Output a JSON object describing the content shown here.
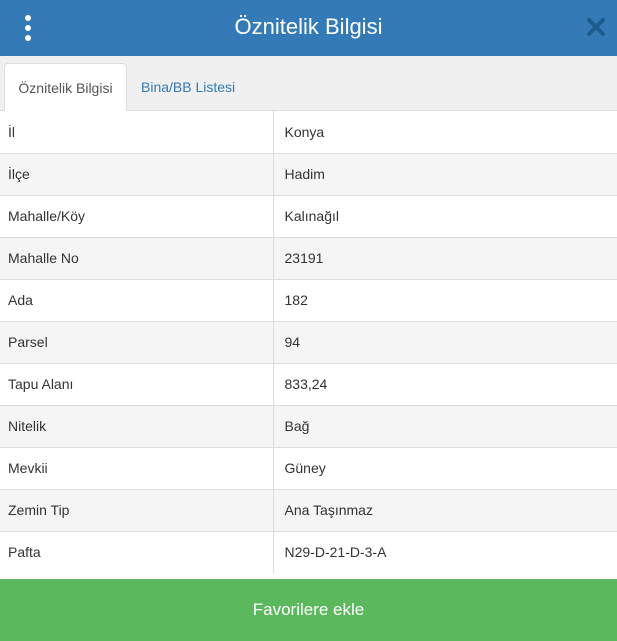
{
  "header": {
    "title": "Öznitelik Bilgisi",
    "menu_icon": "kebab-menu-icon",
    "close_icon": "close-icon",
    "background_color": "#337ab7"
  },
  "tabs": [
    {
      "label": "Öznitelik Bilgisi",
      "active": true
    },
    {
      "label": "Bina/BB Listesi",
      "active": false
    }
  ],
  "attributes": [
    {
      "key": "İl",
      "value": "Konya"
    },
    {
      "key": "İlçe",
      "value": "Hadim"
    },
    {
      "key": "Mahalle/Köy",
      "value": "Kalınağıl"
    },
    {
      "key": "Mahalle No",
      "value": "23191"
    },
    {
      "key": "Ada",
      "value": "182"
    },
    {
      "key": "Parsel",
      "value": "94"
    },
    {
      "key": "Tapu Alanı",
      "value": "833,24"
    },
    {
      "key": "Nitelik",
      "value": "Bağ"
    },
    {
      "key": "Mevkii",
      "value": "Güney"
    },
    {
      "key": "Zemin Tip",
      "value": "Ana Taşınmaz"
    },
    {
      "key": "Pafta",
      "value": "N29-D-21-D-3-A"
    }
  ],
  "footer": {
    "button_label": "Favorilere ekle",
    "button_color": "#5cb85c"
  }
}
